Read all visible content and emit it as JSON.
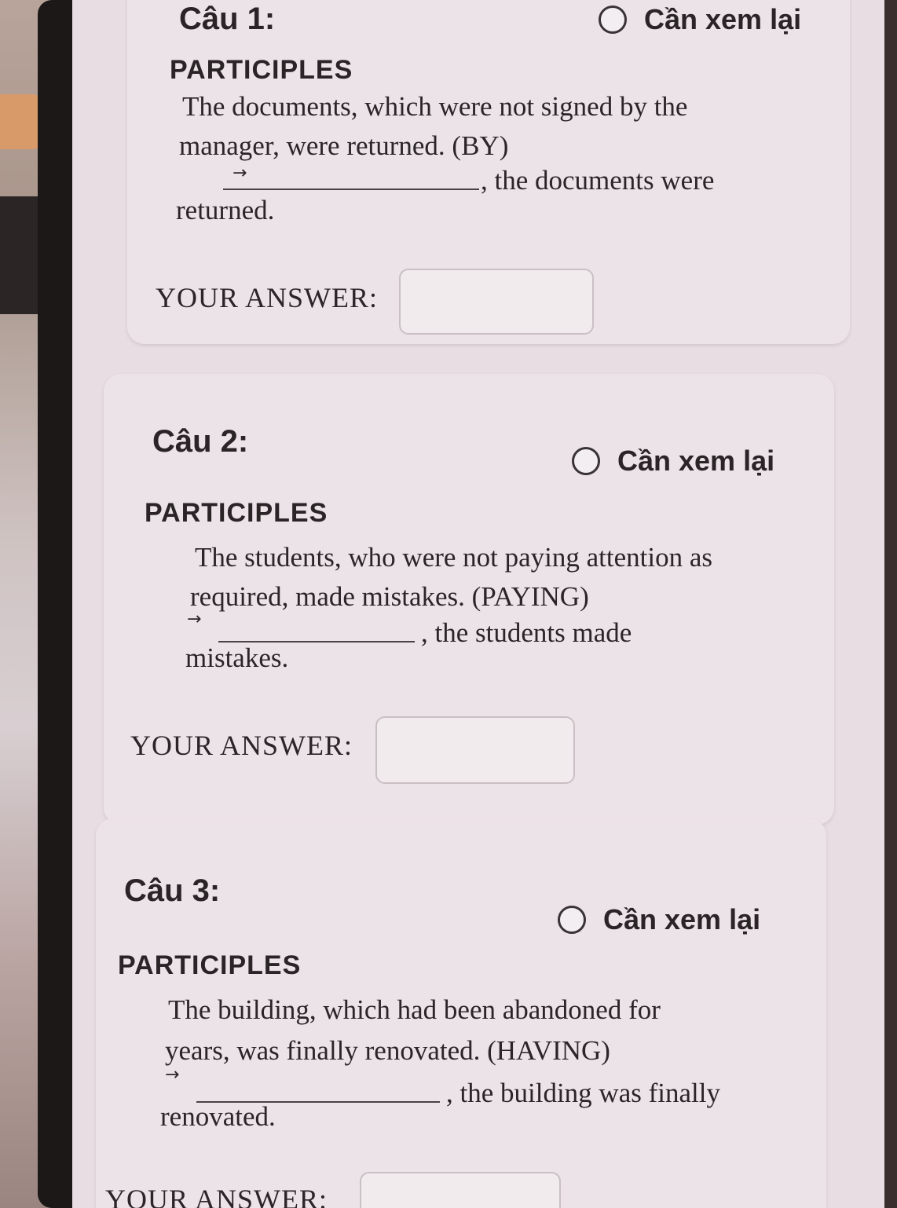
{
  "questions": [
    {
      "title": "Câu 1:",
      "review_label": "Cần xem lại",
      "topic": "PARTICIPLES",
      "sentence_line1": "The documents, which were not signed by the",
      "sentence_line2": "manager, were returned. (BY)",
      "arrow": "→",
      "continuation": ", the documents were",
      "continuation_line2": "returned.",
      "answer_label": "YOUR ANSWER:"
    },
    {
      "title": "Câu 2:",
      "review_label": "Cần xem lại",
      "topic": "PARTICIPLES",
      "sentence_line1": "The students, who were not paying attention as",
      "sentence_line2": "required, made mistakes. (PAYING)",
      "arrow": "→",
      "continuation": ", the students made",
      "continuation_line2": "mistakes.",
      "answer_label": "YOUR ANSWER:"
    },
    {
      "title": "Câu 3:",
      "review_label": "Cần xem lại",
      "topic": "PARTICIPLES",
      "sentence_line1": "The building, which had been abandoned for",
      "sentence_line2": "years, was finally renovated. (HAVING)",
      "arrow": "→",
      "continuation": ", the building was finally",
      "continuation_line2": "renovated.",
      "answer_label": "YOUR ANSWER:"
    }
  ]
}
